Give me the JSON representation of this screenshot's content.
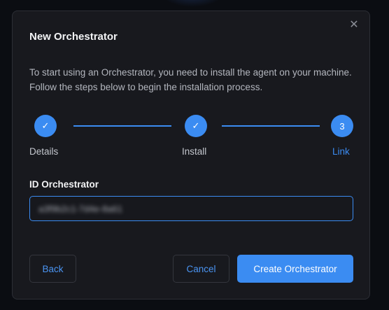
{
  "modal": {
    "title": "New Orchestrator",
    "close_glyph": "✕",
    "description": "To start using an Orchestrator, you need to install the agent on your machine. Follow the steps below to begin the installation process."
  },
  "stepper": {
    "steps": [
      {
        "label": "Details",
        "indicator": "✓",
        "state": "complete"
      },
      {
        "label": "Install",
        "indicator": "✓",
        "state": "complete"
      },
      {
        "label": "Link",
        "indicator": "3",
        "state": "active"
      }
    ],
    "current_step": 3
  },
  "form": {
    "id_label": "ID Orchestrator",
    "id_value": "a3f9b2c1-7d4e-8a61"
  },
  "buttons": {
    "back": "Back",
    "cancel": "Cancel",
    "create": "Create Orchestrator"
  },
  "colors": {
    "accent": "#3b8cf2",
    "modal_bg": "#18191e",
    "page_bg": "#0b0d12"
  }
}
